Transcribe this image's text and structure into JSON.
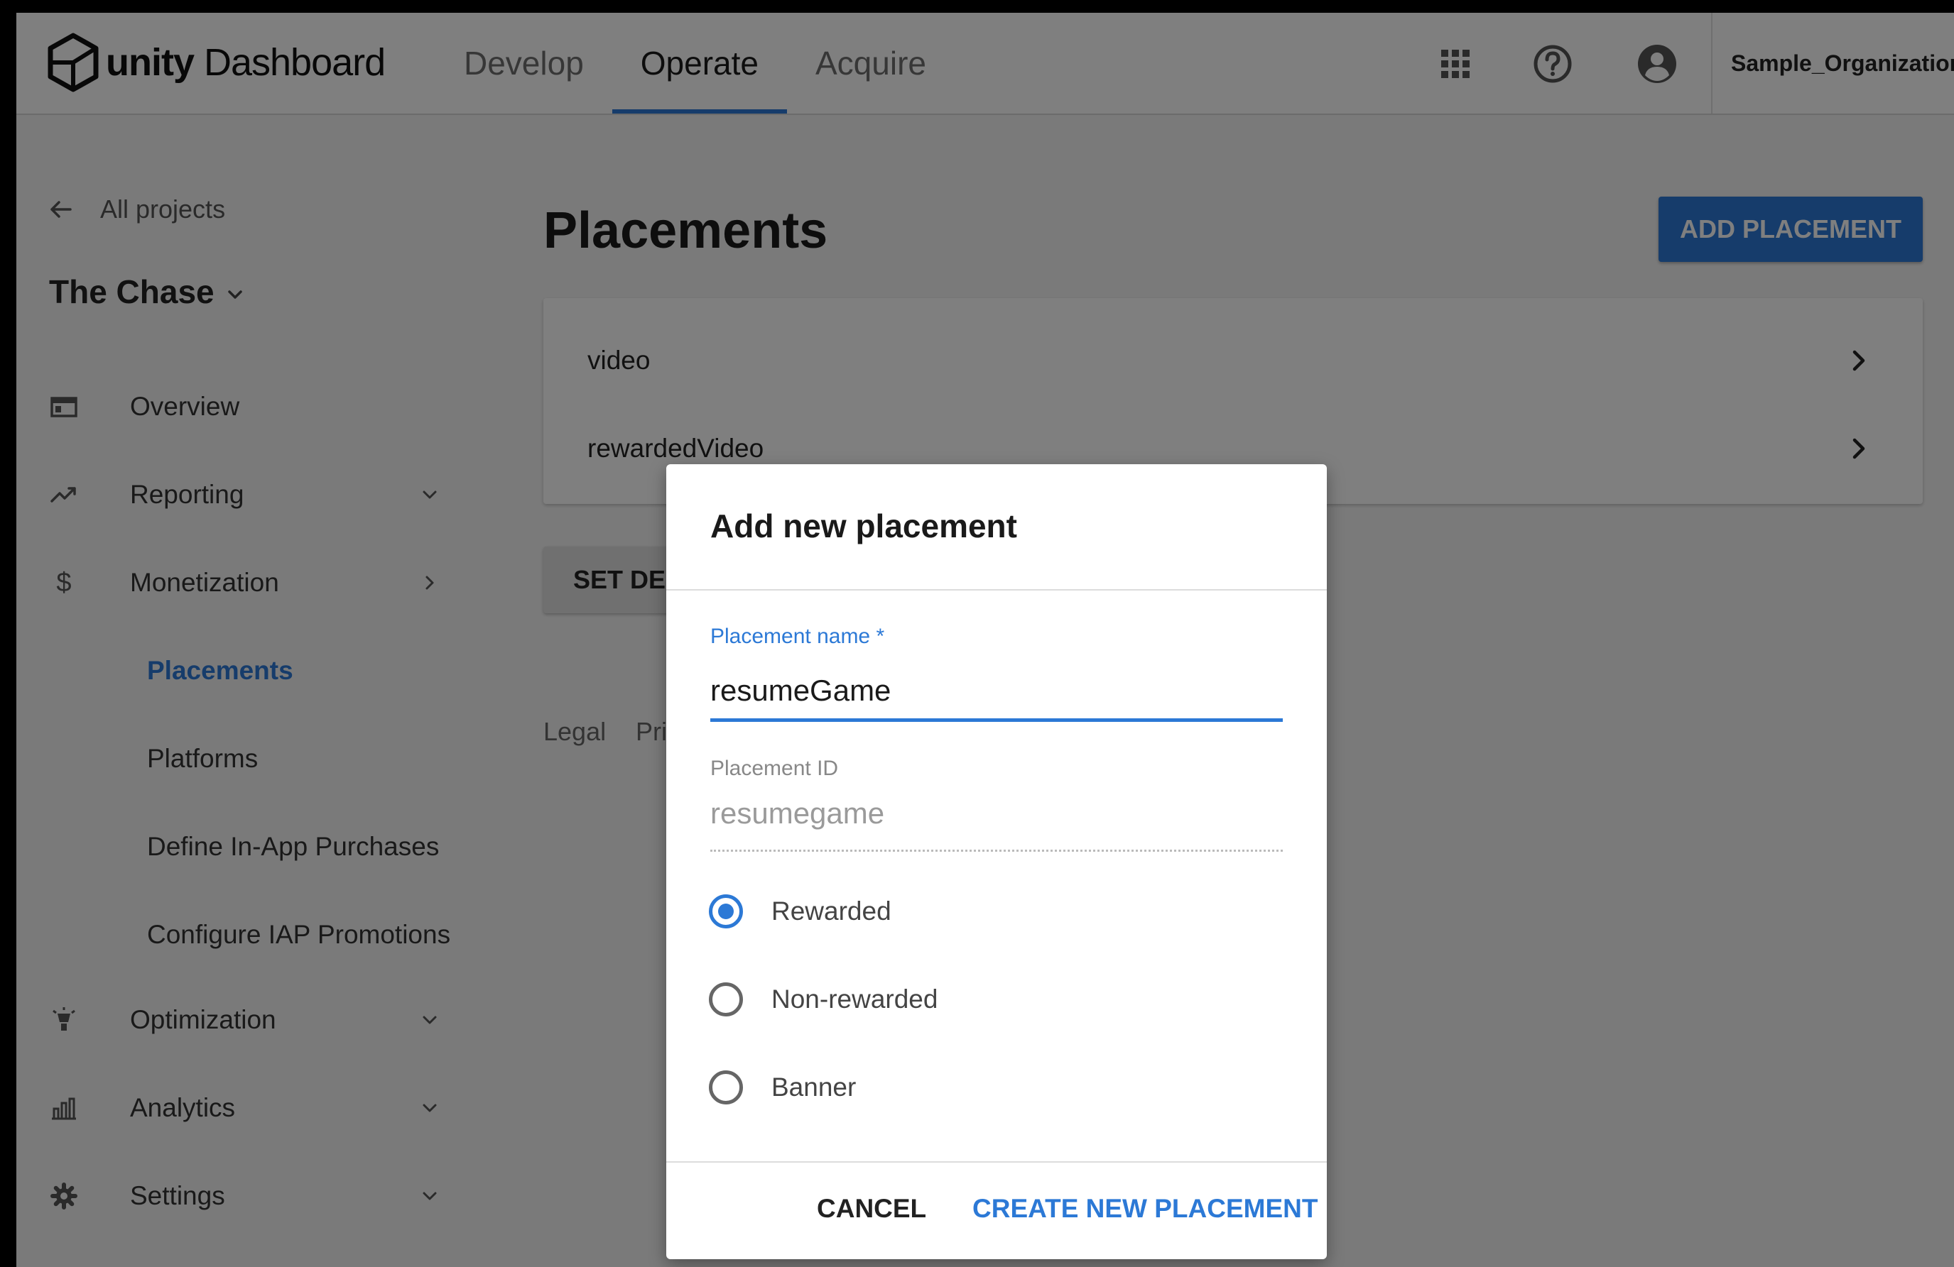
{
  "header": {
    "logo_unity": "unity",
    "logo_dashboard": "Dashboard",
    "tabs": [
      {
        "label": "Develop"
      },
      {
        "label": "Operate"
      },
      {
        "label": "Acquire"
      }
    ],
    "active_tab": "Operate",
    "organization": "Sample_Organization",
    "icons": [
      "apps-grid-icon",
      "help-icon",
      "account-icon"
    ]
  },
  "sidebar": {
    "back_label": "All projects",
    "project_name": "The Chase",
    "items": [
      {
        "label": "Overview",
        "icon": "overview-icon"
      },
      {
        "label": "Reporting",
        "icon": "trending-icon"
      },
      {
        "label": "Monetization",
        "icon": "dollar-icon"
      },
      {
        "label": "Optimization",
        "icon": "lightbulb-icon"
      },
      {
        "label": "Analytics",
        "icon": "bar-chart-icon"
      },
      {
        "label": "Settings",
        "icon": "gear-icon"
      }
    ],
    "monetization_subitems": [
      {
        "label": "Placements"
      },
      {
        "label": "Platforms"
      },
      {
        "label": "Define In-App Purchases"
      },
      {
        "label": "Configure IAP Promotions"
      }
    ],
    "active_subitem": "Placements"
  },
  "main": {
    "title": "Placements",
    "add_button": "ADD PLACEMENT",
    "placements": [
      {
        "name": "video"
      },
      {
        "name": "rewardedVideo"
      }
    ],
    "set_default_button": "SET DEF",
    "footer_links": [
      "Legal",
      "Pri"
    ]
  },
  "dialog": {
    "title": "Add new placement",
    "name_label": "Placement name",
    "required_mark": "*",
    "name_value": "resumeGame",
    "id_label": "Placement ID",
    "id_value": "resumegame",
    "types": [
      {
        "label": "Rewarded"
      },
      {
        "label": "Non-rewarded"
      },
      {
        "label": "Banner"
      }
    ],
    "selected_type": "Rewarded",
    "cancel_button": "CANCEL",
    "create_button": "CREATE NEW PLACEMENT"
  },
  "colors": {
    "accent": "#2c79d6",
    "overlay": "rgba(0,0,0,0.5)"
  }
}
